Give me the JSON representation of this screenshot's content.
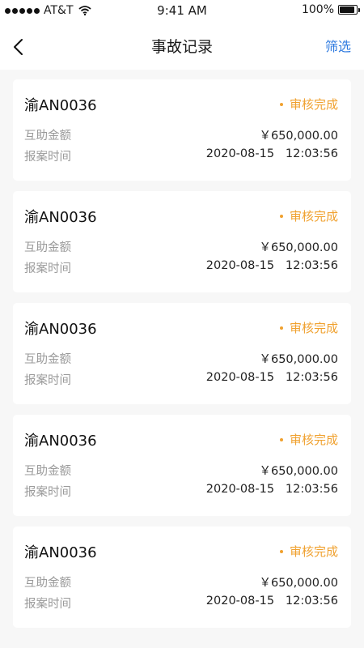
{
  "status_bar": {
    "carrier": "AT&T",
    "time": "9:41 AM",
    "battery": "100%"
  },
  "nav": {
    "title": "事故记录",
    "filter_label": "筛选"
  },
  "records": [
    {
      "plate": "渝AN0036",
      "status": "审核完成",
      "amount_label": "互助金额",
      "amount": "￥650,000.00",
      "time_label": "报案时间",
      "time": "2020-08-15   12:03:56"
    },
    {
      "plate": "渝AN0036",
      "status": "审核完成",
      "amount_label": "互助金额",
      "amount": "￥650,000.00",
      "time_label": "报案时间",
      "time": "2020-08-15   12:03:56"
    },
    {
      "plate": "渝AN0036",
      "status": "审核完成",
      "amount_label": "互助金额",
      "amount": "￥650,000.00",
      "time_label": "报案时间",
      "time": "2020-08-15   12:03:56"
    },
    {
      "plate": "渝AN0036",
      "status": "审核完成",
      "amount_label": "互助金额",
      "amount": "￥650,000.00",
      "time_label": "报案时间",
      "time": "2020-08-15   12:03:56"
    },
    {
      "plate": "渝AN0036",
      "status": "审核完成",
      "amount_label": "互助金额",
      "amount": "￥650,000.00",
      "time_label": "报案时间",
      "time": "2020-08-15   12:03:56"
    }
  ],
  "colors": {
    "accent": "#2f7be0",
    "status": "#f0a12f",
    "background": "#f7f7f7"
  },
  "icons": {
    "back": "chevron-left-icon",
    "wifi": "wifi-icon",
    "battery": "battery-icon"
  }
}
